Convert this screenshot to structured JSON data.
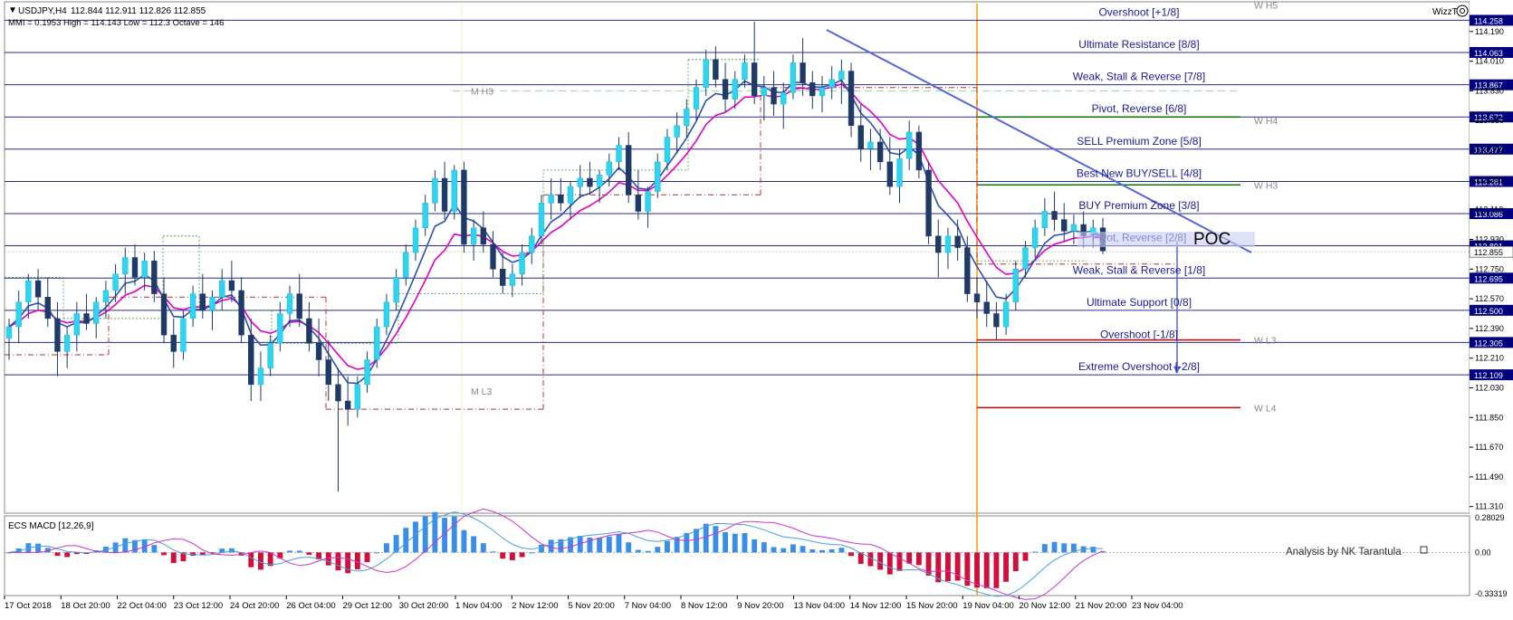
{
  "header": {
    "symbol": "USDJPY,H4",
    "ohlc": "112.844 112.911 112.826 112.855",
    "mmi_line": "MMI = 0.1953   High = 114.143   Low = 112.3   Octave = 146"
  },
  "wizz_label": "WizzT",
  "price_axis": {
    "min": 111.27,
    "max": 114.37,
    "ticks": [
      {
        "value": 114.19,
        "label": "114.190"
      },
      {
        "value": 114.01,
        "label": "114.010"
      },
      {
        "value": 113.83,
        "label": "113.830"
      },
      {
        "value": 113.65,
        "label": "113.650"
      },
      {
        "value": 113.47,
        "label": "113.470"
      },
      {
        "value": 113.29,
        "label": "113.290"
      },
      {
        "value": 113.11,
        "label": "113.110"
      },
      {
        "value": 112.93,
        "label": "112.930"
      },
      {
        "value": 112.75,
        "label": "112.750"
      },
      {
        "value": 112.57,
        "label": "112.570"
      },
      {
        "value": 112.39,
        "label": "112.390"
      },
      {
        "value": 112.21,
        "label": "112.210"
      },
      {
        "value": 112.03,
        "label": "112.030"
      },
      {
        "value": 111.85,
        "label": "111.850"
      },
      {
        "value": 111.67,
        "label": "111.670"
      },
      {
        "value": 111.49,
        "label": "111.490"
      },
      {
        "value": 111.31,
        "label": "111.310"
      }
    ],
    "current_price": {
      "value": 112.855,
      "label": "112.855"
    }
  },
  "murrey_levels": [
    {
      "value": 114.258,
      "label": "Overshoot [+1/8]",
      "price_label": "114.258"
    },
    {
      "value": 114.063,
      "label": "Ultimate Resistance [8/8]",
      "price_label": "114.063"
    },
    {
      "value": 113.867,
      "label": "Weak, Stall & Reverse [7/8]",
      "price_label": "113.867"
    },
    {
      "value": 113.672,
      "label": "Pivot, Reverse [6/8]",
      "price_label": "113.672"
    },
    {
      "value": 113.477,
      "label": "SELL Premium Zone [5/8]",
      "price_label": "113.477"
    },
    {
      "value": 113.281,
      "label": "Best New BUY/SELL [4/8]",
      "price_label": "113.281"
    },
    {
      "value": 113.086,
      "label": "BUY Premium Zone [3/8]",
      "price_label": "113.086"
    },
    {
      "value": 112.891,
      "label": "Pivot, Reverse [2/8]",
      "price_label": "112.891"
    },
    {
      "value": 112.695,
      "label": "Weak, Stall & Reverse [1/8]",
      "price_label": "112.695"
    },
    {
      "value": 112.5,
      "label": "Ultimate Support [0/8]",
      "price_label": "112.500"
    },
    {
      "value": 112.305,
      "label": "Overshoot [-1/8]",
      "price_label": "112.305"
    },
    {
      "value": 112.109,
      "label": "Extreme Overshoot [-2/8]",
      "price_label": "112.109"
    }
  ],
  "pivot_labels": [
    {
      "text": "W H5",
      "value": 114.35
    },
    {
      "text": "M H3",
      "value": 113.83
    },
    {
      "text": "W H4",
      "value": 113.65
    },
    {
      "text": "W H3",
      "value": 113.26
    },
    {
      "text": "W L3",
      "value": 112.32
    },
    {
      "text": "M L3",
      "value": 112.01
    },
    {
      "text": "W L4",
      "value": 111.91
    }
  ],
  "poc_label": "POC",
  "macd": {
    "title": "ECS MACD [12,26,9]",
    "ticks": [
      {
        "value": 0.28029,
        "label": "0.28029"
      },
      {
        "value": 0.0,
        "label": "0.00"
      },
      {
        "value": -0.33319,
        "label": "-0.33319"
      }
    ],
    "credit": "Analysis by NK Tarantula"
  },
  "time_axis": [
    "17 Oct 2018",
    "18 Oct 20:00",
    "22 Oct 04:00",
    "23 Oct 12:00",
    "24 Oct 20:00",
    "26 Oct 04:00",
    "29 Oct 12:00",
    "30 Oct 20:00",
    "1 Nov 04:00",
    "2 Nov 12:00",
    "5 Nov 20:00",
    "7 Nov 04:00",
    "8 Nov 12:00",
    "9 Nov 20:00",
    "13 Nov 04:00",
    "14 Nov 12:00",
    "15 Nov 20:00",
    "19 Nov 04:00",
    "20 Nov 12:00",
    "21 Nov 20:00",
    "23 Nov 04:00"
  ],
  "chart_data": {
    "type": "candlestick",
    "symbol": "USDJPY",
    "timeframe": "H4",
    "ylim": [
      111.27,
      114.37
    ],
    "candles": [
      [
        112.33,
        112.45,
        112.2,
        112.4
      ],
      [
        112.4,
        112.62,
        112.3,
        112.55
      ],
      [
        112.55,
        112.72,
        112.45,
        112.68
      ],
      [
        112.68,
        112.75,
        112.5,
        112.58
      ],
      [
        112.58,
        112.7,
        112.4,
        112.45
      ],
      [
        112.45,
        112.55,
        112.1,
        112.25
      ],
      [
        112.25,
        112.4,
        112.15,
        112.35
      ],
      [
        112.35,
        112.55,
        112.25,
        112.48
      ],
      [
        112.48,
        112.6,
        112.38,
        112.42
      ],
      [
        112.42,
        112.58,
        112.33,
        112.55
      ],
      [
        112.55,
        112.68,
        112.45,
        112.62
      ],
      [
        112.62,
        112.78,
        112.55,
        112.72
      ],
      [
        112.72,
        112.88,
        112.6,
        112.82
      ],
      [
        112.82,
        112.9,
        112.65,
        112.7
      ],
      [
        112.7,
        112.85,
        112.62,
        112.8
      ],
      [
        112.8,
        112.86,
        112.55,
        112.6
      ],
      [
        112.6,
        112.7,
        112.3,
        112.35
      ],
      [
        112.35,
        112.45,
        112.15,
        112.25
      ],
      [
        112.25,
        112.5,
        112.2,
        112.45
      ],
      [
        112.45,
        112.65,
        112.4,
        112.6
      ],
      [
        112.6,
        112.72,
        112.45,
        112.5
      ],
      [
        112.5,
        112.62,
        112.38,
        112.58
      ],
      [
        112.58,
        112.75,
        112.5,
        112.68
      ],
      [
        112.68,
        112.8,
        112.55,
        112.62
      ],
      [
        112.62,
        112.7,
        112.3,
        112.35
      ],
      [
        112.35,
        112.45,
        111.95,
        112.05
      ],
      [
        112.05,
        112.25,
        111.95,
        112.15
      ],
      [
        112.15,
        112.35,
        112.1,
        112.3
      ],
      [
        112.3,
        112.55,
        112.25,
        112.48
      ],
      [
        112.48,
        112.65,
        112.4,
        112.6
      ],
      [
        112.6,
        112.72,
        112.4,
        112.45
      ],
      [
        112.45,
        112.55,
        112.25,
        112.3
      ],
      [
        112.3,
        112.45,
        112.1,
        112.2
      ],
      [
        112.2,
        112.32,
        111.95,
        112.05
      ],
      [
        112.05,
        112.15,
        111.4,
        111.95
      ],
      [
        111.95,
        112.1,
        111.8,
        111.9
      ],
      [
        111.9,
        112.1,
        111.85,
        112.05
      ],
      [
        112.05,
        112.25,
        112.0,
        112.2
      ],
      [
        112.2,
        112.45,
        112.15,
        112.4
      ],
      [
        112.4,
        112.6,
        112.35,
        112.55
      ],
      [
        112.55,
        112.75,
        112.5,
        112.7
      ],
      [
        112.7,
        112.9,
        112.65,
        112.85
      ],
      [
        112.85,
        113.05,
        112.8,
        113.0
      ],
      [
        113.0,
        113.2,
        112.95,
        113.15
      ],
      [
        113.15,
        113.35,
        113.1,
        113.3
      ],
      [
        113.3,
        113.4,
        113.05,
        113.1
      ],
      [
        113.1,
        113.38,
        113.05,
        113.35
      ],
      [
        113.35,
        113.4,
        112.85,
        112.9
      ],
      [
        112.9,
        113.05,
        112.8,
        113.0
      ],
      [
        113.0,
        113.1,
        112.85,
        112.9
      ],
      [
        112.9,
        112.98,
        112.7,
        112.75
      ],
      [
        112.75,
        112.85,
        112.6,
        112.65
      ],
      [
        112.65,
        112.78,
        112.58,
        112.72
      ],
      [
        112.72,
        112.9,
        112.65,
        112.85
      ],
      [
        112.85,
        113.0,
        112.78,
        112.95
      ],
      [
        112.95,
        113.2,
        112.9,
        113.15
      ],
      [
        113.15,
        113.3,
        113.05,
        113.2
      ],
      [
        113.2,
        113.3,
        113.1,
        113.15
      ],
      [
        113.15,
        113.28,
        113.05,
        113.25
      ],
      [
        113.25,
        113.38,
        113.18,
        113.3
      ],
      [
        113.3,
        113.4,
        113.2,
        113.25
      ],
      [
        113.25,
        113.35,
        113.15,
        113.32
      ],
      [
        113.32,
        113.45,
        113.25,
        113.4
      ],
      [
        113.4,
        113.55,
        113.35,
        113.5
      ],
      [
        113.5,
        113.58,
        113.15,
        113.2
      ],
      [
        113.2,
        113.35,
        113.05,
        113.1
      ],
      [
        113.1,
        113.25,
        113.0,
        113.22
      ],
      [
        113.22,
        113.45,
        113.18,
        113.4
      ],
      [
        113.4,
        113.6,
        113.35,
        113.55
      ],
      [
        113.55,
        113.7,
        113.45,
        113.62
      ],
      [
        113.62,
        113.78,
        113.55,
        113.72
      ],
      [
        113.72,
        113.9,
        113.65,
        113.85
      ],
      [
        113.85,
        114.08,
        113.8,
        114.02
      ],
      [
        114.02,
        114.1,
        113.85,
        113.9
      ],
      [
        113.9,
        114.0,
        113.7,
        113.78
      ],
      [
        113.78,
        113.95,
        113.72,
        113.9
      ],
      [
        113.9,
        114.05,
        113.85,
        114.0
      ],
      [
        114.0,
        114.25,
        113.75,
        113.8
      ],
      [
        113.8,
        113.92,
        113.65,
        113.85
      ],
      [
        113.85,
        113.95,
        113.68,
        113.75
      ],
      [
        113.75,
        113.88,
        113.6,
        113.82
      ],
      [
        113.82,
        114.05,
        113.78,
        114.0
      ],
      [
        114.0,
        114.15,
        113.8,
        113.88
      ],
      [
        113.88,
        113.95,
        113.72,
        113.8
      ],
      [
        113.8,
        113.92,
        113.7,
        113.85
      ],
      [
        113.85,
        113.98,
        113.78,
        113.9
      ],
      [
        113.9,
        114.02,
        113.75,
        113.95
      ],
      [
        113.95,
        114.0,
        113.55,
        113.62
      ],
      [
        113.62,
        113.75,
        113.4,
        113.48
      ],
      [
        113.48,
        113.6,
        113.35,
        113.52
      ],
      [
        113.52,
        113.6,
        113.35,
        113.4
      ],
      [
        113.4,
        113.55,
        113.2,
        113.25
      ],
      [
        113.25,
        113.48,
        113.15,
        113.42
      ],
      [
        113.42,
        113.65,
        113.35,
        113.58
      ],
      [
        113.58,
        113.62,
        113.3,
        113.35
      ],
      [
        113.35,
        113.4,
        112.9,
        112.95
      ],
      [
        112.95,
        113.05,
        112.7,
        112.85
      ],
      [
        112.85,
        113.0,
        112.75,
        112.95
      ],
      [
        112.95,
        113.05,
        112.8,
        112.88
      ],
      [
        112.88,
        112.95,
        112.55,
        112.6
      ],
      [
        112.6,
        112.7,
        112.45,
        112.55
      ],
      [
        112.55,
        112.68,
        112.4,
        112.48
      ],
      [
        112.48,
        112.55,
        112.32,
        112.4
      ],
      [
        112.4,
        112.6,
        112.35,
        112.55
      ],
      [
        112.55,
        112.8,
        112.5,
        112.75
      ],
      [
        112.75,
        112.92,
        112.7,
        112.88
      ],
      [
        112.88,
        113.05,
        112.82,
        113.0
      ],
      [
        113.0,
        113.18,
        112.95,
        113.1
      ],
      [
        113.1,
        113.22,
        112.98,
        113.05
      ],
      [
        113.05,
        113.15,
        112.92,
        112.98
      ],
      [
        112.98,
        113.08,
        112.9,
        113.02
      ],
      [
        113.02,
        113.1,
        112.88,
        112.95
      ],
      [
        112.95,
        113.05,
        112.88,
        113.0
      ],
      [
        113.0,
        113.06,
        112.84,
        112.86
      ]
    ],
    "current_price": 112.855,
    "macd_ylim": [
      -0.33319,
      0.28029
    ]
  }
}
